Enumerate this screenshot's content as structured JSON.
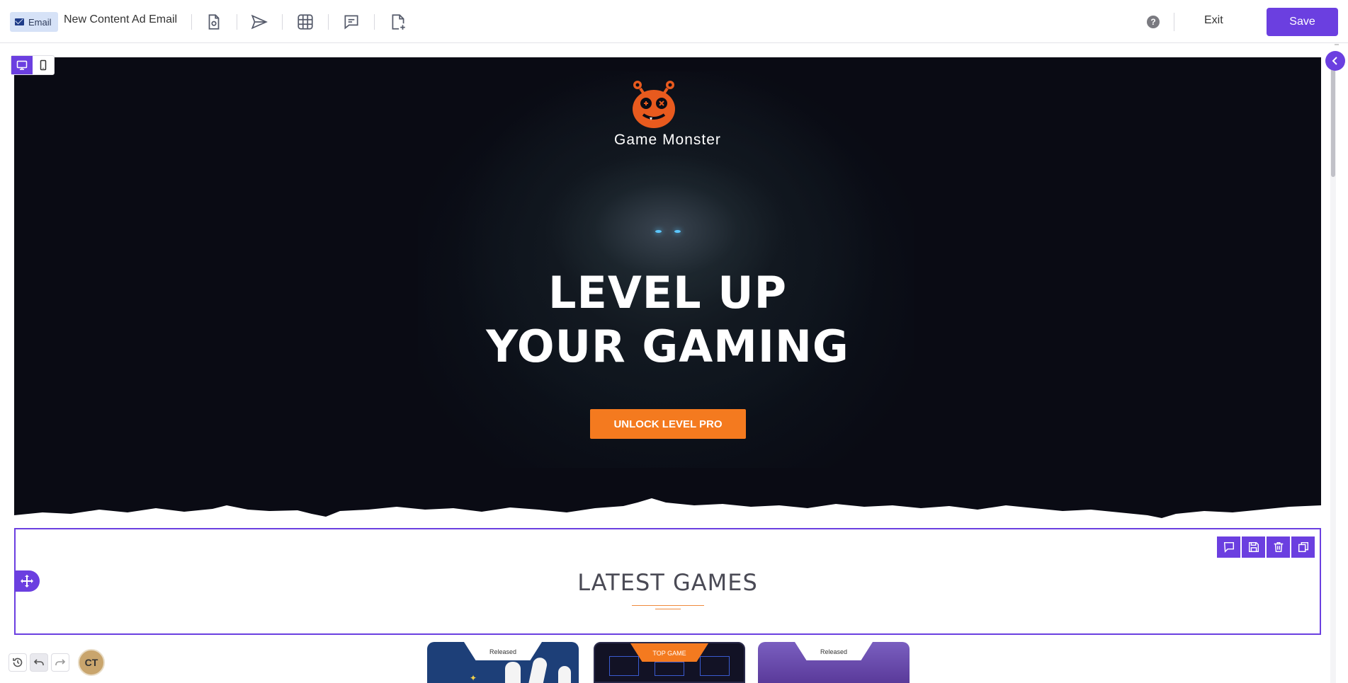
{
  "toolbar": {
    "badge_label": "Email",
    "document_title": "New Content Ad Email",
    "help_label": "?",
    "exit_label": "Exit",
    "save_label": "Save",
    "icons": [
      "preview-doc-icon",
      "send-icon",
      "grid-icon",
      "comment-icon",
      "add-page-icon"
    ]
  },
  "device_toggle": {
    "active": "desktop",
    "options": [
      "desktop-icon",
      "mobile-icon"
    ]
  },
  "hero": {
    "brand_name": "Game Monster",
    "headline_line1": "LEVEL UP",
    "headline_line2": "YOUR GAMING",
    "cta_label": "UNLOCK LEVEL PRO"
  },
  "section": {
    "title": "LATEST GAMES",
    "tools": [
      "comment-icon",
      "save-icon",
      "trash-icon",
      "duplicate-icon"
    ]
  },
  "cards": [
    {
      "tag": "Released",
      "tag_style": "white",
      "color": "#1d3f78"
    },
    {
      "tag": "TOP GAME",
      "tag_style": "orange",
      "color": "#121225"
    },
    {
      "tag": "Released",
      "tag_style": "white",
      "color": "#5a3a9a"
    }
  ],
  "bottom_controls": {
    "avatar_initials": "CT"
  },
  "colors": {
    "accent": "#6b3fe0",
    "cta": "#f47a1f",
    "hero_bg": "#0a0b14",
    "logo": "#e85a1e"
  }
}
